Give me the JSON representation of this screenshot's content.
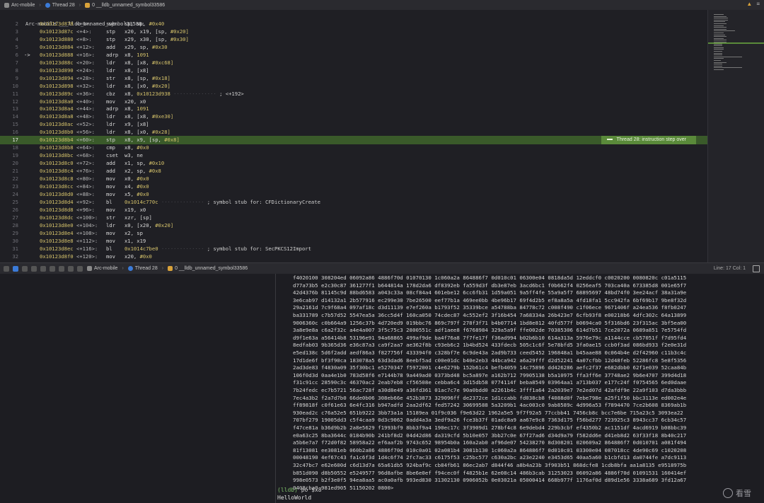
{
  "breadcrumb": {
    "items": [
      {
        "label": "Arc-mobile",
        "icon": "app-icon"
      },
      {
        "label": "Thread 28",
        "icon": "thread-icon"
      },
      {
        "label": "0 __lldb_unnamed_symbol33586",
        "icon": "frame-icon"
      }
    ]
  },
  "editor": {
    "header": "Arc-mobile`___lldb_unnamed_symbol33586:",
    "current_line": 17,
    "pc_line": 6,
    "lines": [
      {
        "n": "2",
        "addr": "0x10123d878",
        "off": "<+0>:",
        "mn": "sub",
        "ops": "sp, sp, ",
        "num": "#0x40",
        "cmt": ""
      },
      {
        "n": "3",
        "addr": "0x10123d87c",
        "off": "<+4>:",
        "mn": "stp",
        "ops": "x20, x19, [sp, ",
        "num": "#0x20]",
        "cmt": ""
      },
      {
        "n": "4",
        "addr": "0x10123d880",
        "off": "<+8>:",
        "mn": "stp",
        "ops": "x29, x30, [sp, ",
        "num": "#0x30]",
        "cmt": ""
      },
      {
        "n": "5",
        "addr": "0x10123d884",
        "off": "<+12>:",
        "mn": "add",
        "ops": "x29, sp, ",
        "num": "#0x30",
        "cmt": ""
      },
      {
        "n": "6",
        "addr": "0x10123d888",
        "off": "<+16>:",
        "mn": "adrp",
        "ops": "x8, ",
        "num": "1091",
        "cmt": ""
      },
      {
        "n": "7",
        "addr": "0x10123d88c",
        "off": "<+20>:",
        "mn": "ldr",
        "ops": "x8, [x8, ",
        "num": "#0xc68]",
        "cmt": ""
      },
      {
        "n": "8",
        "addr": "0x10123d890",
        "off": "<+24>:",
        "mn": "ldr",
        "ops": "x8, [x8]",
        "num": "",
        "cmt": ""
      },
      {
        "n": "9",
        "addr": "0x10123d894",
        "off": "<+28>:",
        "mn": "str",
        "ops": "x8, [sp, ",
        "num": "#0x18]",
        "cmt": ""
      },
      {
        "n": "10",
        "addr": "0x10123d898",
        "off": "<+32>:",
        "mn": "ldr",
        "ops": "x8, [x0, ",
        "num": "#0x20]",
        "cmt": ""
      },
      {
        "n": "11",
        "addr": "0x10123d89c",
        "off": "<+36>:",
        "mn": "cbz",
        "ops": "x8, ",
        "num": "0x10123d938",
        "cmt": "; <+192>"
      },
      {
        "n": "12",
        "addr": "0x10123d8a0",
        "off": "<+40>:",
        "mn": "mov",
        "ops": "x20, x0",
        "num": "",
        "cmt": ""
      },
      {
        "n": "13",
        "addr": "0x10123d8a4",
        "off": "<+44>:",
        "mn": "adrp",
        "ops": "x8, ",
        "num": "1091",
        "cmt": ""
      },
      {
        "n": "14",
        "addr": "0x10123d8a8",
        "off": "<+48>:",
        "mn": "ldr",
        "ops": "x8, [x8, ",
        "num": "#0xe30]",
        "cmt": ""
      },
      {
        "n": "15",
        "addr": "0x10123d8ac",
        "off": "<+52>:",
        "mn": "ldr",
        "ops": "x9, [x8]",
        "num": "",
        "cmt": ""
      },
      {
        "n": "16",
        "addr": "0x10123d8b0",
        "off": "<+56>:",
        "mn": "ldr",
        "ops": "x8, [x0, ",
        "num": "#0x28]",
        "cmt": ""
      },
      {
        "n": "17",
        "addr": "0x10123d8b4",
        "off": "<+60>:",
        "mn": "stp",
        "ops": "x8, x9, [sp, ",
        "num": "#0x8]",
        "cmt": ""
      },
      {
        "n": "18",
        "addr": "0x10123d8b8",
        "off": "<+64>:",
        "mn": "cmp",
        "ops": "x8, ",
        "num": "#0x0",
        "cmt": ""
      },
      {
        "n": "19",
        "addr": "0x10123d8bc",
        "off": "<+68>:",
        "mn": "cset",
        "ops": "w3, ne",
        "num": "",
        "cmt": ""
      },
      {
        "n": "20",
        "addr": "0x10123d8c0",
        "off": "<+72>:",
        "mn": "add",
        "ops": "x1, sp, ",
        "num": "#0x10",
        "cmt": ""
      },
      {
        "n": "21",
        "addr": "0x10123d8c4",
        "off": "<+76>:",
        "mn": "add",
        "ops": "x2, sp, ",
        "num": "#0x8",
        "cmt": ""
      },
      {
        "n": "22",
        "addr": "0x10123d8c8",
        "off": "<+80>:",
        "mn": "mov",
        "ops": "x0, ",
        "num": "#0x0",
        "cmt": ""
      },
      {
        "n": "23",
        "addr": "0x10123d8cc",
        "off": "<+84>:",
        "mn": "mov",
        "ops": "x4, ",
        "num": "#0x0",
        "cmt": ""
      },
      {
        "n": "24",
        "addr": "0x10123d8d0",
        "off": "<+88>:",
        "mn": "mov",
        "ops": "x5, ",
        "num": "#0x0",
        "cmt": ""
      },
      {
        "n": "25",
        "addr": "0x10123d8d4",
        "off": "<+92>:",
        "mn": "bl",
        "ops": "",
        "num": "0x1014c770c",
        "cmt": "; symbol stub for: CFDictionaryCreate"
      },
      {
        "n": "26",
        "addr": "0x10123d8d8",
        "off": "<+96>:",
        "mn": "mov",
        "ops": "x19, x0",
        "num": "",
        "cmt": ""
      },
      {
        "n": "27",
        "addr": "0x10123d8dc",
        "off": "<+100>:",
        "mn": "str",
        "ops": "xzr, [sp]",
        "num": "",
        "cmt": ""
      },
      {
        "n": "28",
        "addr": "0x10123d8e0",
        "off": "<+104>:",
        "mn": "ldr",
        "ops": "x0, [x20, ",
        "num": "#0x20]",
        "cmt": ""
      },
      {
        "n": "29",
        "addr": "0x10123d8e4",
        "off": "<+108>:",
        "mn": "mov",
        "ops": "x2, sp",
        "num": "",
        "cmt": ""
      },
      {
        "n": "30",
        "addr": "0x10123d8e8",
        "off": "<+112>:",
        "mn": "mov",
        "ops": "x1, x19",
        "num": "",
        "cmt": ""
      },
      {
        "n": "31",
        "addr": "0x10123d8ec",
        "off": "<+116>:",
        "mn": "bl",
        "ops": "",
        "num": "0x1014c7be0",
        "cmt": "; symbol stub for: SecPKCS12Import"
      },
      {
        "n": "32",
        "addr": "0x10123d8f0",
        "off": "<+120>:",
        "mn": "mov",
        "ops": "x20, ",
        "num": "#0x0",
        "cmt": ""
      }
    ],
    "badge": "Thread 28: instruction step over"
  },
  "debug_bar": {
    "items": [
      {
        "label": "Arc-mobile"
      },
      {
        "label": "Thread 28"
      },
      {
        "label": "0 __lldb_unnamed_symbol33586"
      }
    ],
    "position": "Line: 17  Col: 1"
  },
  "console": {
    "hex_rows": [
      "f4020100 308204ed 06092a86 4886f70d 01070130 1c060a2a 864886f7 0d010c01 06300e04 0818da5d 12eddcf0 c0020200 0080820c c01a5115",
      "d77a73b5 e2c30c87 361277f1 b644814a 178d2da6 df8392eb fa559d3f db3e87eb 3acd6bc1 f0b662f4 0256eaf5 703ca40a 673385d8 001e65f7",
      "42d4376b 81145c9d 88bd6583 a043c33a 08cf84a4 601ebe12 6cc6fb31 1d59a051 9a5ff4fe 55a9a5f7 68895697 48bd74f0 3ee24acf 38a31a9e",
      "3e6cab97 d14132a1 2b577916 ec299e30 7be26500 eef77b1a 469ee0bb 4be96b17 69f4d2b5 ef8a8a5a 4fd18fa1 5cc942fa 6bf69b17 9be8f32d",
      "29a2161d 7c9f68a4 097af18c d3d11139 e7ef260a b1793f52 35339bce a54788ba 84778c72 c008f490 c1f06ece 9671406f a24ea536 f8fb0247",
      "ba331789 c7b57d52 5547ea5a 36cc5d4f 160ca050 74cdec87 4c552ef2 3f16b454 7a68334a 26b423e7 6cfb93f8 e00218b6 4dfc302c 64a13899",
      "9006360c c0b664a9 1256c37b 4d720ed9 019bbc76 869c797f 278f3f71 b4b07714 1bd8e812 40fd577f b0694ca0 5f316bd6 23f315ac 3bf5ea00",
      "3a8e9e8a c6a2f32c a4e4a007 3f5c75c3 2800551c adf1aee8 f6768984 329a5a9f ffe002de 70385306 614d7b51 7ce2072a 0689a851 7e5754fd",
      "d9f1e63a a56414b8 53196e91 94a68865 499af9de ba4f76a8 7f7fe17f f36ad994 b02b6b10 614a313a 5976e79c a1144cce cb57051f f7d95fd4",
      "8edfab03 9b365d36 e36c87a3 ca9f2aa7 ae362f8b c93eb6c2 1b4bd524 433fdecb 505c1c6f 5e78bfd5 3fa0ae15 ccb0f3ad 086bd933 f2e0e31d",
      "e5ed138c 5d6f2add aedf86a3 f827756f 433394f0 c328bf7e 6c9de43a 2ad9b733 ceed5452 196848a1 b45aae88 0c064b4e d2f42960 c11b3c4c",
      "17d1de6f bf3f90ca 183078a5 63d3dad6 8eebf5ad c00e01dc b40e2eb3 44bca942 a6a29fff d2d52241 4a07cfbb 12d48feb 52286fc8 5e8f5356",
      "2ad3de83 f4830a09 35f30bc1 e5270347 f5972001 c4e6279b 152b61c4 befb4059 14c75896 dd426286 aefc2f37 e682dbb0 62f1e039 52caa84b",
      "106f0d3d 0aa4e1b0 783d58f6 e7144b78 9a449ad0 0373bd48 bc5a897e a162b712 79905138 b5a10975 ffa3ff6e 37748ae2 9b6e4707 399d4d18",
      "f31c91cc 28590c3c 46370ac2 2eab7eb8 cf56508e cebba6c4 3d15db58 0774114f beba8549 03964aa1 a713b037 e177c24f f0754565 6ed0daae",
      "7b24fedc ec7b5721 56ac728f a30d8e49 a36fd361 01ac7c7e 90a0bdd0 a2261b4c 3fff1a64 2a2039e7 7e2ed07d 42afdf9e 22a9f103 d7da3bbb",
      "7ec4a3b2 f2a7d7b0 66de0b06 308eb66e 452b3873 329096ff de2372ce 1d1ccabb fd038cb8 f4088d0f 7ebe798e a25f1f50 bbc3113e ed002e4e",
      "ff89818f c0f61e63 6e4fc316 b947adfd 2aa2df62 fed57242 30699588 5a3209b1 4ac003c0 9ab8589c 4d996a53 f7894470 7ce2b608 8369ab1b",
      "930ead2c c76a52e5 651b9222 3bb73a1a 15189ea 01f9c036 f9e63d22 1962a5e5 9f7f92a5 77ccbb41 7456cb8c bcc7e6be 715a23c5 3093ea22",
      "707bf279 19005dd3 c5f4caa9 0d3c9062 0add4a3a 3edf9a26 fce3b37f 01adc8a9 aa67e9c8 7363d175 f56bd277 723925c3 8943cc37 6cb34c57",
      "f47ce81a b36d9b2b 2a8e5629 f1993bf9 8bb3f9a4 190ec17c 3f3909d1 278bf4c8 6e9debd4 229b3cbf ef4350b2 ac1151df 4acd6919 b08bbc39",
      "e0a63c25 8ba3644c 0184b90b 241bf8d2 04d42d86 da319cfd 5b10e057 3bb27c0e 67f27ad6 d34d9a79 f582dd6e d41eb8d2 63f33f18 8b40c217",
      "a5b6e7a7 f72d0f82 58958a22 ef6aaf2b 9743c652 98954b0a 160a2ab0 af96de07 54238270 8d308201 020609a2 864886f7 0d010701 a081f494",
      "81f13081 ee3081eb 060b2a86 4886f70d 010c0a01 02a081b4 3081b130 1c060a2a 864886f7 0d010c01 03300e04 087018cc 4de90c69 c1020208",
      "00048190 4ef67c43 fa1c6f3d 1d4c6f74 2fc7ac33 c6175f53 c25bc577 c630a2bc a23e2240 e3453d65 40aa5a60 b1cbfd13 da0744fe a7dc9113",
      "32c47bc7 e62e600d c6d13d7a 65a61db5 924baf9c cb84fb61 86ec2ab7 d844f46 a8b4a23b 3f903b51 868dcfe8 1cdb8bfa aa1a8135 e9518975b",
      "b851d090 d8b50552 e5249577 96d8afbe 8be6e0ef f94cec0f f4825b1e 62e08c14 486b3cab 31253023 06092a86 4886f70d 01091531 160414ef",
      "998e0573 b2f3e0f5 94ea8aa5 ac0a0afb 993ed830 31302130 0906052b 0e03021a 05000414 668b977f 1176af0d d89d1e56 3338a689 3fd12a67",
      "0408cba0 981ed905 51150202 0800>"
    ],
    "prompt_label": "(lldb)",
    "command": " po $x8",
    "output": "HelloWorld"
  },
  "watermark": {
    "text": "看雪"
  },
  "colors": {
    "highlight": "#3a5a2a",
    "badge": "#5a8a3a",
    "lldb_prompt": "#7fc16a",
    "address": "#d6c36b"
  }
}
